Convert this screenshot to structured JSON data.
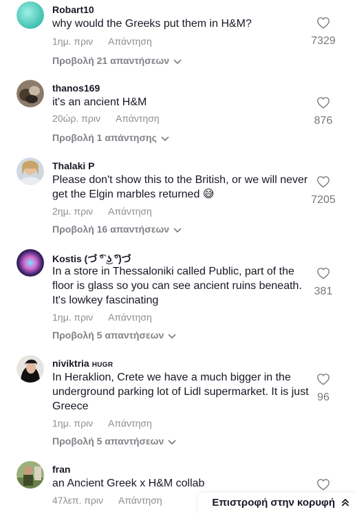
{
  "comments": [
    {
      "username": "Robart10",
      "badge": "",
      "text": "why would the Greeks put them in H&M?",
      "time": "1ημ. πριν",
      "reply_label": "Απάντηση",
      "likes": "7329",
      "replies_label": "Προβολή 21 απαντήσεων",
      "avatar_color": "#5fd3c4"
    },
    {
      "username": "thanos169",
      "badge": "",
      "text": "it's an ancient H&M",
      "time": "20ώρ. πριν",
      "reply_label": "Απάντηση",
      "likes": "876",
      "replies_label": "Προβολή 1 απάντησης",
      "avatar_color": "#6b5a4a"
    },
    {
      "username": "Thalaki P",
      "badge": "",
      "text": "Please don't show this to the British, or we will never get the Elgin marbles returned 😅",
      "time": "2ημ. πριν",
      "reply_label": "Απάντηση",
      "likes": "7205",
      "replies_label": "Προβολή 16 απαντήσεων",
      "avatar_color": "#d9c9b2"
    },
    {
      "username": "Kostis (づ ͡° ͜ʖ ͡°)づ",
      "badge": "",
      "text": "In a store in Thessaloniki called Public, part of the floor is glass so you can see ancient ruins beneath. It's lowkey fascinating",
      "time": "1ημ. πριν",
      "reply_label": "Απάντηση",
      "likes": "381",
      "replies_label": "Προβολή 5 απαντήσεων",
      "avatar_color": "#2a1b4a"
    },
    {
      "username": "niviktria",
      "badge": "HUGR",
      "text": "In Heraklion, Crete we have a much bigger in the underground parking lot of Lidl supermarket. It is just Greece",
      "time": "1ημ. πριν",
      "reply_label": "Απάντηση",
      "likes": "96",
      "replies_label": "Προβολή 5 απαντήσεων",
      "avatar_color": "#3a3a3a"
    },
    {
      "username": "fran",
      "badge": "",
      "text": "an Ancient Greek x H&M collab",
      "time": "47λεπ. πριν",
      "reply_label": "Απάντηση",
      "likes": "",
      "replies_label": "",
      "avatar_color": "#8aa06a"
    }
  ],
  "back_to_top": {
    "label": "Επιστροφή στην κορυφή",
    "icon": "double-chevron-up-icon"
  },
  "colors": {
    "text": "#161823",
    "muted": "#8a8b91"
  }
}
